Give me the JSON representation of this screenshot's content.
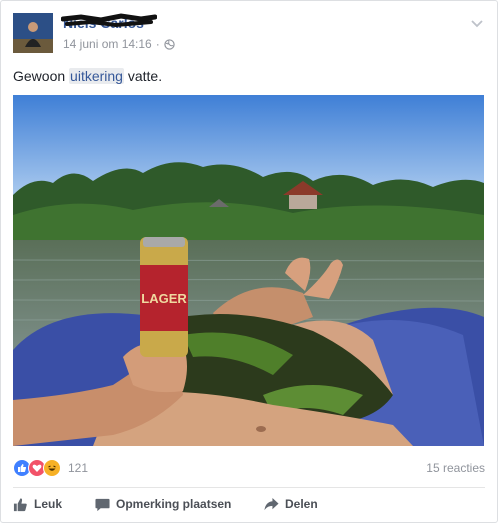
{
  "post": {
    "author_name": "Niels Carlos",
    "timestamp": "14 juni om 14:16",
    "audience_icon": "globe-icon",
    "text_before": "Gewoon ",
    "text_link": "uitkering",
    "text_after": " vatte."
  },
  "can": {
    "label": "LAGER"
  },
  "reactions": {
    "icons": [
      "like-icon",
      "love-icon",
      "haha-icon"
    ],
    "count": "121",
    "comments": "15 reacties"
  },
  "actions": {
    "like": "Leuk",
    "comment": "Opmerking plaatsen",
    "share": "Delen"
  },
  "colors": {
    "link": "#365899",
    "meta": "#90949c",
    "like_blue": "#4080ff",
    "love_red": "#f25268",
    "haha_yellow": "#f7b125"
  }
}
